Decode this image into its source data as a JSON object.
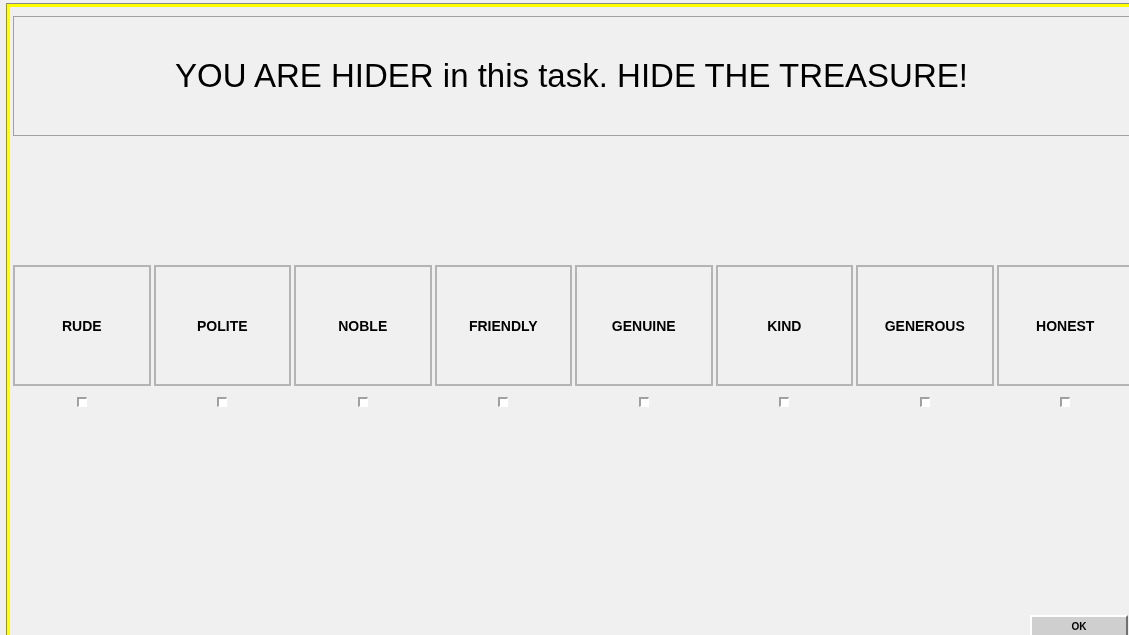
{
  "header": {
    "title": "YOU ARE HIDER in this task. HIDE THE TREASURE!"
  },
  "options": [
    {
      "label": "RUDE",
      "checked": false
    },
    {
      "label": "POLITE",
      "checked": false
    },
    {
      "label": "NOBLE",
      "checked": false
    },
    {
      "label": "FRIENDLY",
      "checked": false
    },
    {
      "label": "GENUINE",
      "checked": false
    },
    {
      "label": "KIND",
      "checked": false
    },
    {
      "label": "GENEROUS",
      "checked": false
    },
    {
      "label": "HONEST",
      "checked": false
    }
  ],
  "ok_button": {
    "label": "OK"
  }
}
